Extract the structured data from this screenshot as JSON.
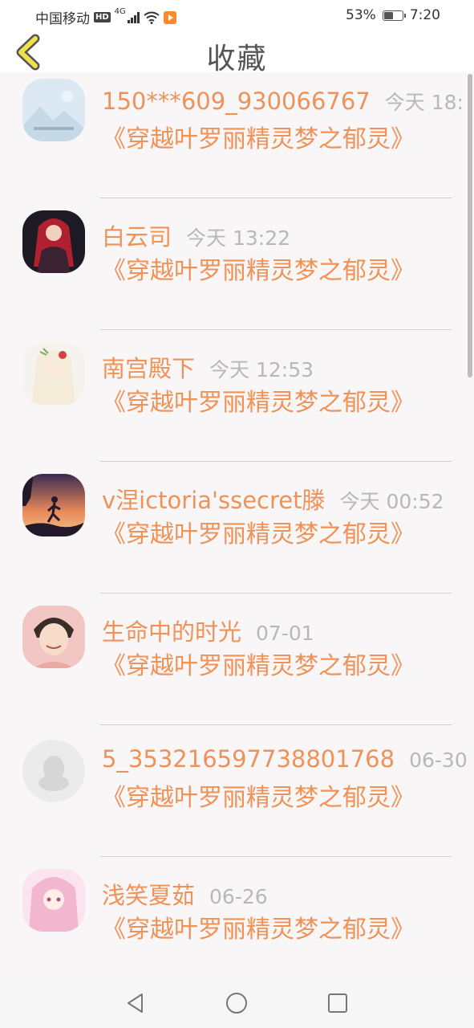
{
  "status_bar": {
    "carrier": "中国移动",
    "hd": "HD",
    "network": "4G",
    "battery_percent": "53%",
    "battery_level": 0.53,
    "time": "7:20"
  },
  "header": {
    "title": "收藏",
    "back_icon": "chevron-left-icon"
  },
  "accent_color": "#ef9258",
  "favorites": [
    {
      "name": "150***609_930066767",
      "time": "今天 18:",
      "title": "《穿越叶罗丽精灵梦之郁灵》",
      "avatar": "landscape-placeholder"
    },
    {
      "name": "白云司",
      "time": "今天 13:22",
      "title": "《穿越叶罗丽精灵梦之郁灵》",
      "avatar": "red-hair-girl"
    },
    {
      "name": "南宫殿下",
      "time": "今天 12:53",
      "title": "《穿越叶罗丽精灵梦之郁灵》",
      "avatar": "white-hair-girl"
    },
    {
      "name": "v涅ictoria'ssecret滕",
      "time": "今天 00:52",
      "title": "《穿越叶罗丽精灵梦之郁灵》",
      "avatar": "sunset-runner"
    },
    {
      "name": "生命中的时光",
      "time": "07-01",
      "title": "《穿越叶罗丽精灵梦之郁灵》",
      "avatar": "anime-boy"
    },
    {
      "name": "5_353216597738801768",
      "time": "06-30",
      "title": "《穿越叶罗丽精灵梦之郁灵》",
      "avatar": "default-penguin"
    },
    {
      "name": "浅笑夏茹",
      "time": "06-26",
      "title": "《穿越叶罗丽精灵梦之郁灵》",
      "avatar": "pink-hair-girl"
    }
  ],
  "nav": [
    "back-triangle-icon",
    "home-circle-icon",
    "recents-square-icon"
  ]
}
